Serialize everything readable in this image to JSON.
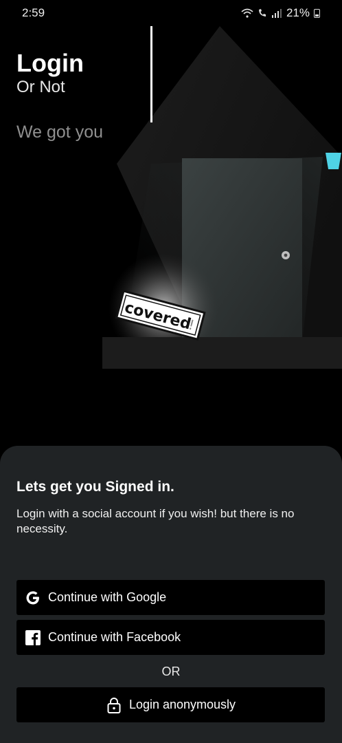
{
  "status_bar": {
    "time": "2:59",
    "battery": "21%",
    "icons": [
      "wifi-icon",
      "call-icon",
      "signal-icon",
      "battery-icon"
    ]
  },
  "hero": {
    "title": "Login",
    "subtitle": "Or Not",
    "tagline": "We got you",
    "sign_text": "covered",
    "sign_mark": "!"
  },
  "sheet": {
    "title": "Lets get you Signed in.",
    "description": "Login with a social account if you wish! but there is no necessity.",
    "google_label": "Continue with Google",
    "facebook_label": "Continue with Facebook",
    "or_label": "OR",
    "anonymous_label": "Login anonymously"
  },
  "colors": {
    "background": "#000000",
    "sheet": "#202325",
    "button": "#000000",
    "lamp_accent": "#4fd3e6"
  }
}
